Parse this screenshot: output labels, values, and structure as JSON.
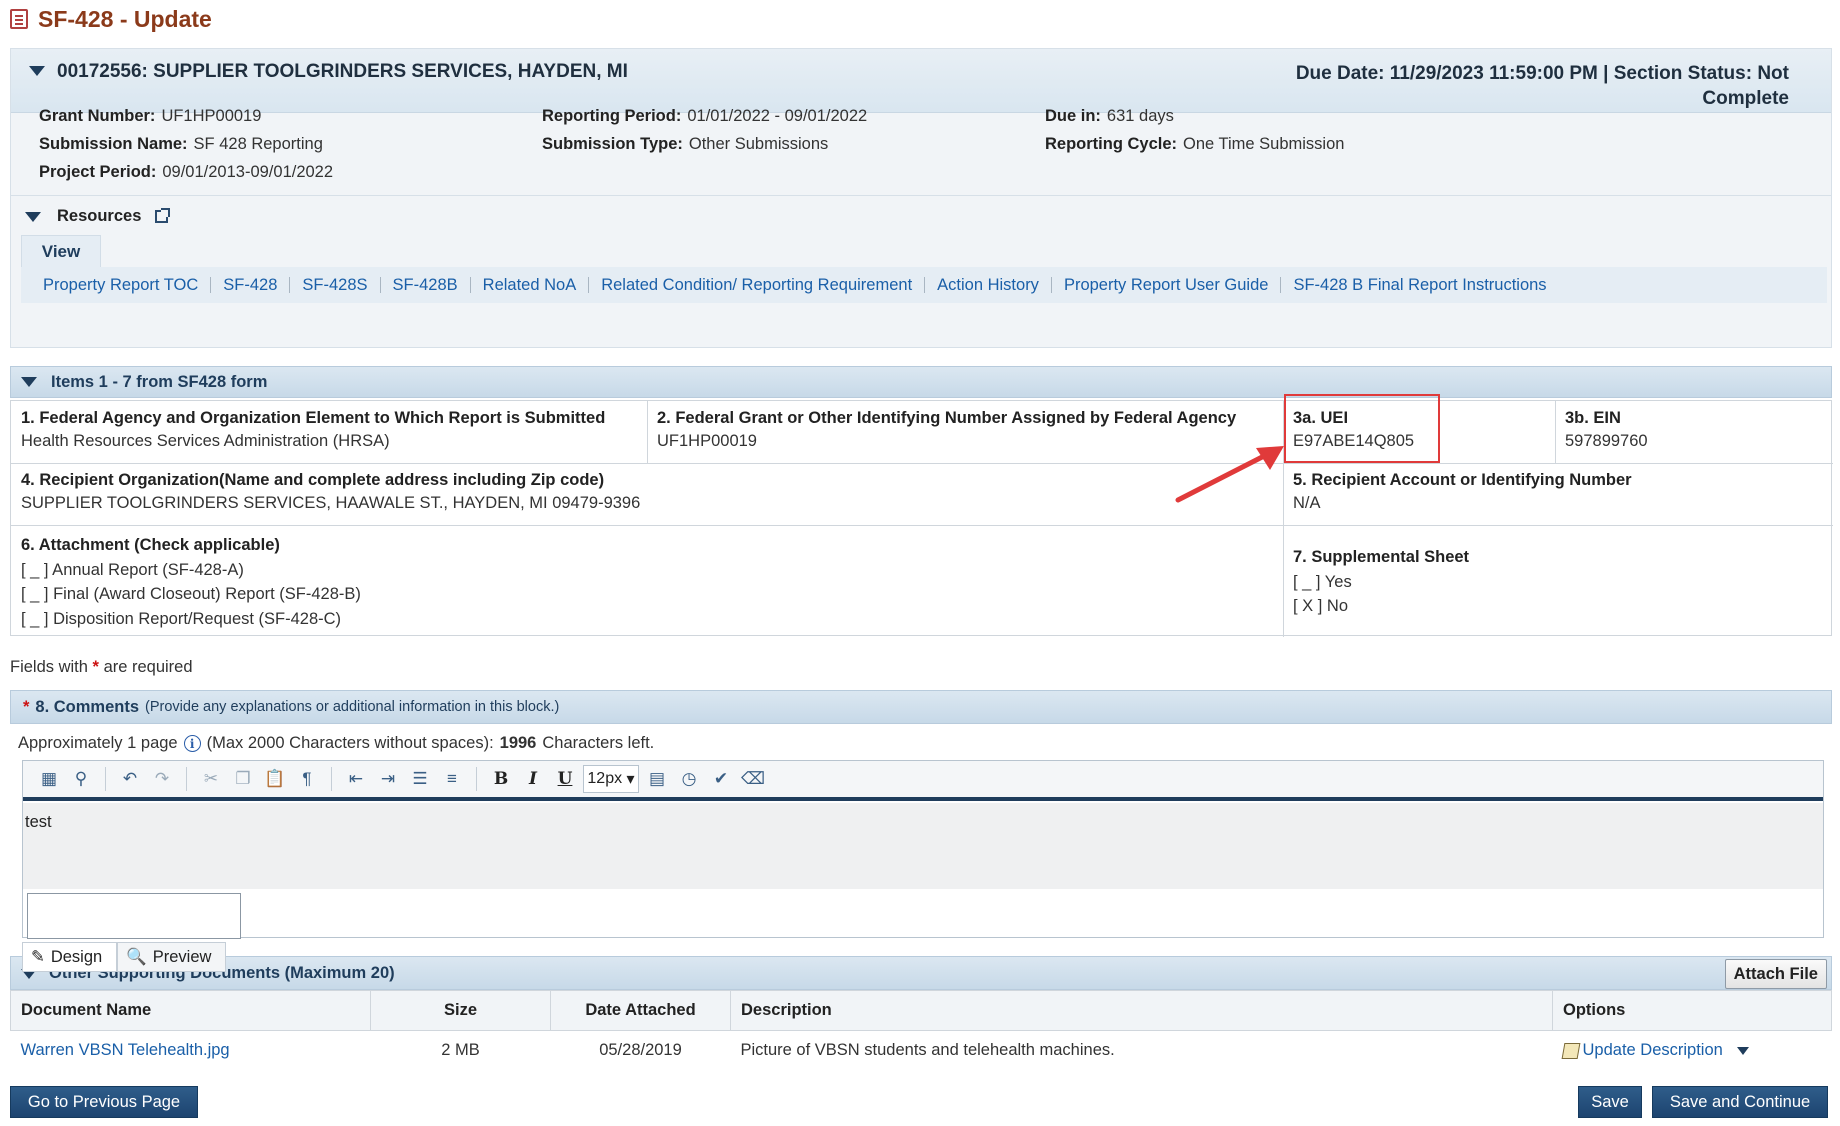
{
  "page": {
    "title": "SF-428 - Update"
  },
  "header": {
    "org": "00172556: SUPPLIER TOOLGRINDERS SERVICES, HAYDEN, MI",
    "due": "Due Date: 11/29/2023 11:59:00 PM | Section Status: Not Complete",
    "fields": {
      "grant_number": {
        "label": "Grant Number:",
        "value": "UF1HP00019"
      },
      "submission_name": {
        "label": "Submission Name:",
        "value": "SF 428 Reporting"
      },
      "project_period": {
        "label": "Project Period:",
        "value": "09/01/2013-09/01/2022"
      },
      "reporting_period": {
        "label": "Reporting Period:",
        "value": "01/01/2022 - 09/01/2022"
      },
      "submission_type": {
        "label": "Submission Type:",
        "value": "Other Submissions"
      },
      "due_in": {
        "label": "Due in:",
        "value": "631 days"
      },
      "reporting_cycle": {
        "label": "Reporting Cycle:",
        "value": "One Time Submission"
      }
    }
  },
  "resources": {
    "label": "Resources",
    "view_tab": "View",
    "links": [
      "Property Report TOC",
      "SF-428",
      "SF-428S",
      "SF-428B",
      "Related NoA",
      "Related Condition/ Reporting Requirement",
      "Action History",
      "Property Report User Guide",
      "SF-428 B Final Report Instructions"
    ]
  },
  "items": {
    "title": "Items 1 - 7 from SF428 form",
    "f1": {
      "label": "1. Federal Agency and Organization Element to Which Report is Submitted",
      "value": "Health Resources Services Administration (HRSA)"
    },
    "f2": {
      "label": "2. Federal Grant or Other Identifying Number Assigned by Federal Agency",
      "value": "UF1HP00019"
    },
    "f3a": {
      "label": "3a. UEI",
      "value": "E97ABE14Q805"
    },
    "f3b": {
      "label": "3b. EIN",
      "value": "597899760"
    },
    "f4": {
      "label": "4. Recipient Organization(Name and complete address including Zip code)",
      "value": "SUPPLIER TOOLGRINDERS SERVICES, HAAWALE ST., HAYDEN, MI 09479-9396"
    },
    "f5": {
      "label": "5. Recipient Account or Identifying Number",
      "value": "N/A"
    },
    "f6": {
      "label": "6. Attachment (Check applicable)",
      "options": [
        "[ _ ] Annual Report (SF-428-A)",
        "[ _ ] Final (Award Closeout) Report (SF-428-B)",
        "[ _ ] Disposition Report/Request (SF-428-C)"
      ]
    },
    "f7": {
      "label": "7. Supplemental Sheet",
      "options": [
        "[ _ ] Yes",
        "[ X ] No"
      ]
    }
  },
  "required_note": {
    "pre": "Fields with",
    "post": "are required"
  },
  "comments": {
    "title": "8. Comments",
    "hint": "(Provide any explanations or additional information in this block.)",
    "approx_pre": "Approximately 1 page",
    "approx_mid": "(Max 2000 Characters without spaces):",
    "chars_left": "1996",
    "approx_post": "Characters left.",
    "font_size": "12px",
    "text": "test",
    "tabs": {
      "design": "Design",
      "preview": "Preview"
    }
  },
  "documents": {
    "title": "Other Supporting Documents (Maximum 20)",
    "attach_label": "Attach File",
    "columns": [
      "Document Name",
      "Size",
      "Date Attached",
      "Description",
      "Options"
    ],
    "rows": [
      {
        "name": "Warren VBSN Telehealth.jpg",
        "size": "2 MB",
        "date": "05/28/2019",
        "description": "Picture of VBSN students and telehealth machines.",
        "option": "Update Description"
      }
    ]
  },
  "footer": {
    "prev_label": "Go to Previous Page",
    "save_label": "Save",
    "save_continue_label": "Save and Continue"
  },
  "colors": {
    "accent": "#1f3d5c",
    "title": "#8b3a1a",
    "highlight": "#e03a3a",
    "link": "#1a5fa8"
  }
}
